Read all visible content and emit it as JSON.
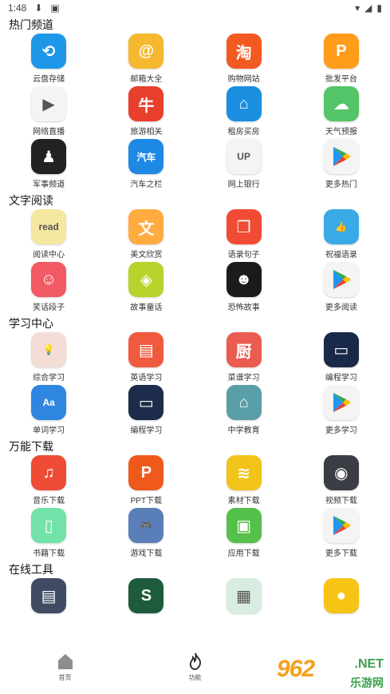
{
  "status_bar": {
    "time": "1:48"
  },
  "sections": [
    {
      "title": "热门频道",
      "items": [
        {
          "label": "云盘存储",
          "icon": "cloud-sync-icon",
          "bg": "#1e97e8",
          "glyph": "⟲"
        },
        {
          "label": "邮箱大全",
          "icon": "mail-icon",
          "bg": "#f5b82e",
          "glyph": "@"
        },
        {
          "label": "购物网站",
          "icon": "taobao-icon",
          "bg": "#f25a22",
          "glyph": "淘"
        },
        {
          "label": "批发平台",
          "icon": "wholesale-icon",
          "bg": "#ff9c1a",
          "glyph": "P"
        },
        {
          "label": "网络直播",
          "icon": "live-stream-icon",
          "bg": "#f4f4f4",
          "glyph": "▶"
        },
        {
          "label": "旅游相关",
          "icon": "cow-mascot-icon",
          "bg": "#e8402c",
          "glyph": "牛"
        },
        {
          "label": "租房买房",
          "icon": "house-icon",
          "bg": "#1a8fe0",
          "glyph": "⌂"
        },
        {
          "label": "天气预报",
          "icon": "weather-icon",
          "bg": "#54c468",
          "glyph": "☁"
        },
        {
          "label": "军事频道",
          "icon": "military-icon",
          "bg": "#222222",
          "glyph": "♟"
        },
        {
          "label": "汽车之栏",
          "icon": "car-home-icon",
          "bg": "#1e88e5",
          "glyph": "汽车"
        },
        {
          "label": "网上银行",
          "icon": "unionpay-icon",
          "bg": "#f4f4f4",
          "glyph": "UP"
        },
        {
          "label": "更多热门",
          "icon": "play-store-icon",
          "bg": "#f4f4f4",
          "glyph": "▶"
        }
      ]
    },
    {
      "title": "文字阅读",
      "items": [
        {
          "label": "阅读中心",
          "icon": "read-note-icon",
          "bg": "#f6e7a0",
          "glyph": "read"
        },
        {
          "label": "美文欣赏",
          "icon": "article-icon",
          "bg": "#ffab3f",
          "glyph": "文"
        },
        {
          "label": "语录句子",
          "icon": "bookmark-icon",
          "bg": "#f24b33",
          "glyph": "❐"
        },
        {
          "label": "祝福语录",
          "icon": "thumbs-up-icon",
          "bg": "#3aaae6",
          "glyph": "👍"
        },
        {
          "label": "笑话段子",
          "icon": "smile-icon",
          "bg": "#f15a62",
          "glyph": "☺"
        },
        {
          "label": "故事童话",
          "icon": "story-icon",
          "bg": "#b7d42c",
          "glyph": "◈"
        },
        {
          "label": "恐怖故事",
          "icon": "horror-icon",
          "bg": "#1d1b19",
          "glyph": "☻"
        },
        {
          "label": "更多阅读",
          "icon": "play-store-icon",
          "bg": "#f4f4f4",
          "glyph": "▶"
        }
      ]
    },
    {
      "title": "学习中心",
      "items": [
        {
          "label": "综合学习",
          "icon": "lightbulb-icon",
          "bg": "#f3ddd5",
          "glyph": "💡"
        },
        {
          "label": "英语学习",
          "icon": "english-icon",
          "bg": "#f05a3f",
          "glyph": "▤"
        },
        {
          "label": "菜谱学习",
          "icon": "kitchen-icon",
          "bg": "#ea5b50",
          "glyph": "厨"
        },
        {
          "label": "编程学习",
          "icon": "laptop-icon",
          "bg": "#19294a",
          "glyph": "▭"
        },
        {
          "label": "单词学习",
          "icon": "dictionary-icon",
          "bg": "#2f86e0",
          "glyph": "Aa"
        },
        {
          "label": "编程学习",
          "icon": "laptop-icon",
          "bg": "#1d2c4a",
          "glyph": "▭"
        },
        {
          "label": "中学教育",
          "icon": "school-icon",
          "bg": "#5a9fa8",
          "glyph": "⌂"
        },
        {
          "label": "更多学习",
          "icon": "play-store-icon",
          "bg": "#f4f4f4",
          "glyph": "▶"
        }
      ]
    },
    {
      "title": "万能下载",
      "items": [
        {
          "label": "音乐下载",
          "icon": "music-download-icon",
          "bg": "#ef4b35",
          "glyph": "♫"
        },
        {
          "label": "PPT下载",
          "icon": "ppt-icon",
          "bg": "#ef5a1c",
          "glyph": "P"
        },
        {
          "label": "素材下载",
          "icon": "layers-icon",
          "bg": "#f2c318",
          "glyph": "≋"
        },
        {
          "label": "视频下载",
          "icon": "video-icon",
          "bg": "#3a3d44",
          "glyph": "◉"
        },
        {
          "label": "书籍下载",
          "icon": "book-icon",
          "bg": "#72e2a8",
          "glyph": "▯"
        },
        {
          "label": "游戏下载",
          "icon": "gamepad-icon",
          "bg": "#5a7fb8",
          "glyph": "🎮"
        },
        {
          "label": "应用下载",
          "icon": "app-bag-icon",
          "bg": "#55c04a",
          "glyph": "▣"
        },
        {
          "label": "更多下载",
          "icon": "play-store-icon",
          "bg": "#f4f4f4",
          "glyph": "▶"
        }
      ]
    },
    {
      "title": "在线工具",
      "items": [
        {
          "label": "",
          "icon": "briefcase-icon",
          "bg": "#3f4c64",
          "glyph": "▤"
        },
        {
          "label": "",
          "icon": "green-s-icon",
          "bg": "#1e5a3c",
          "glyph": "S"
        },
        {
          "label": "",
          "icon": "image-icon",
          "bg": "#d8ece0",
          "glyph": "▦"
        },
        {
          "label": "",
          "icon": "color-drops-icon",
          "bg": "#f7c415",
          "glyph": "●"
        }
      ]
    }
  ],
  "bottom_nav": [
    {
      "label": "首页",
      "icon": "home-icon"
    },
    {
      "label": "功能",
      "icon": "flame-icon"
    }
  ],
  "watermark": {
    "number": "962",
    "net": ".NET",
    "site": "乐游网"
  }
}
